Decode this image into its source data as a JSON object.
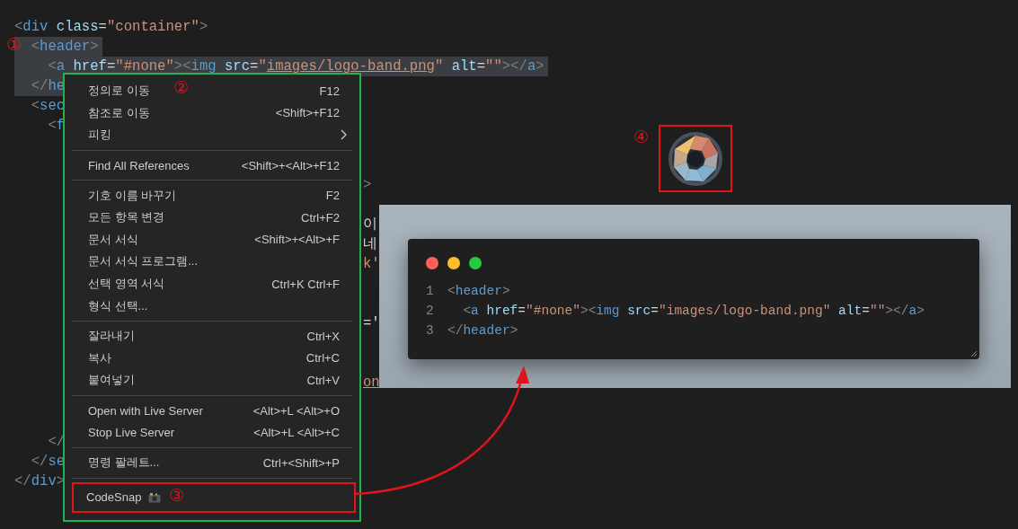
{
  "editor": {
    "lines": [
      {
        "kind": "code",
        "highlighted": false,
        "tokens": [
          {
            "text": "<",
            "kind": "punct"
          },
          {
            "text": "div",
            "kind": "tag"
          },
          {
            "text": " class",
            "kind": "attr"
          },
          {
            "text": "=",
            "kind": "text"
          },
          {
            "text": "\"container\"",
            "kind": "string"
          },
          {
            "text": ">",
            "kind": "punct"
          }
        ]
      },
      {
        "kind": "code",
        "highlighted": true,
        "tokens": [
          {
            "text": "  <",
            "kind": "punct"
          },
          {
            "text": "header",
            "kind": "tag"
          },
          {
            "text": ">",
            "kind": "punct"
          }
        ]
      },
      {
        "kind": "code",
        "highlighted": true,
        "tokens": [
          {
            "text": "    <",
            "kind": "punct"
          },
          {
            "text": "a",
            "kind": "tag"
          },
          {
            "text": " href",
            "kind": "attr"
          },
          {
            "text": "=",
            "kind": "text"
          },
          {
            "text": "\"#none\"",
            "kind": "string"
          },
          {
            "text": "><",
            "kind": "punct"
          },
          {
            "text": "img",
            "kind": "tag"
          },
          {
            "text": " src",
            "kind": "attr"
          },
          {
            "text": "=",
            "kind": "text"
          },
          {
            "text": "\"",
            "kind": "string"
          },
          {
            "text": "images/logo-band.png",
            "kind": "link"
          },
          {
            "text": "\"",
            "kind": "string"
          },
          {
            "text": " alt",
            "kind": "attr"
          },
          {
            "text": "=",
            "kind": "text"
          },
          {
            "text": "\"\"",
            "kind": "string"
          },
          {
            "text": "></",
            "kind": "punct"
          },
          {
            "text": "a",
            "kind": "tag"
          },
          {
            "text": ">",
            "kind": "punct"
          }
        ]
      },
      {
        "kind": "code",
        "highlighted": true,
        "tokens": [
          {
            "text": "  </",
            "kind": "punct"
          },
          {
            "text": "he",
            "kind": "tag"
          }
        ]
      },
      {
        "kind": "code",
        "highlighted": false,
        "tokens": [
          {
            "text": "  <",
            "kind": "punct"
          },
          {
            "text": "sec",
            "kind": "tag"
          }
        ]
      },
      {
        "kind": "code",
        "highlighted": false,
        "tokens": [
          {
            "text": "    <",
            "kind": "punct"
          },
          {
            "text": "f",
            "kind": "tag"
          }
        ]
      },
      {
        "kind": "blank"
      },
      {
        "kind": "blank"
      },
      {
        "kind": "tail",
        "tail": {
          "text": ">",
          "kind": "punct"
        }
      },
      {
        "kind": "blank"
      },
      {
        "kind": "tail",
        "tail": {
          "text": "이",
          "kind": "text"
        }
      },
      {
        "kind": "tail",
        "tail": {
          "text": "네",
          "kind": "text"
        }
      },
      {
        "kind": "tail",
        "tail": {
          "text": "k'",
          "kind": "string"
        }
      },
      {
        "kind": "blank"
      },
      {
        "kind": "blank"
      },
      {
        "kind": "tail",
        "tail": {
          "text": "='",
          "kind": "text"
        }
      },
      {
        "kind": "blank"
      },
      {
        "kind": "blank"
      },
      {
        "kind": "tail",
        "tail": {
          "text": "on",
          "kind": "link"
        }
      },
      {
        "kind": "blank"
      },
      {
        "kind": "blank"
      },
      {
        "kind": "code",
        "highlighted": false,
        "tokens": [
          {
            "text": "    </",
            "kind": "punct"
          }
        ]
      },
      {
        "kind": "code",
        "highlighted": false,
        "tokens": [
          {
            "text": "  </",
            "kind": "punct"
          },
          {
            "text": "se",
            "kind": "tag"
          }
        ]
      },
      {
        "kind": "code",
        "highlighted": false,
        "tokens": [
          {
            "text": "</",
            "kind": "punct"
          },
          {
            "text": "div",
            "kind": "tag"
          },
          {
            "text": ">",
            "kind": "punct"
          }
        ]
      }
    ]
  },
  "context_menu": {
    "groups": [
      [
        {
          "kind": "item",
          "label": "정의로 이동",
          "shortcut": "F12"
        },
        {
          "kind": "item",
          "label": "참조로 이동",
          "shortcut": "<Shift>+F12"
        },
        {
          "kind": "submenu",
          "label": "피킹"
        }
      ],
      [
        {
          "kind": "item",
          "label": "Find All References",
          "shortcut": "<Shift>+<Alt>+F12"
        }
      ],
      [
        {
          "kind": "item",
          "label": "기호 이름 바꾸기",
          "shortcut": "F2"
        },
        {
          "kind": "item",
          "label": "모든 항목 변경",
          "shortcut": "Ctrl+F2"
        },
        {
          "kind": "item",
          "label": "문서 서식",
          "shortcut": "<Shift>+<Alt>+F"
        },
        {
          "kind": "item",
          "label": "문서 서식 프로그램..."
        },
        {
          "kind": "item",
          "label": "선택 영역 서식",
          "shortcut": "Ctrl+K Ctrl+F"
        },
        {
          "kind": "item",
          "label": "형식 선택..."
        }
      ],
      [
        {
          "kind": "item",
          "label": "잘라내기",
          "shortcut": "Ctrl+X"
        },
        {
          "kind": "item",
          "label": "복사",
          "shortcut": "Ctrl+C"
        },
        {
          "kind": "item",
          "label": "붙여넣기",
          "shortcut": "Ctrl+V"
        }
      ],
      [
        {
          "kind": "item",
          "label": "Open with Live Server",
          "shortcut": "<Alt>+L <Alt>+O"
        },
        {
          "kind": "item",
          "label": "Stop Live Server",
          "shortcut": "<Alt>+L <Alt>+C"
        }
      ],
      [
        {
          "kind": "item",
          "label": "명령 팔레트...",
          "shortcut": "Ctrl+<Shift>+P"
        }
      ],
      [
        {
          "kind": "extension",
          "label": "CodeSnap"
        }
      ]
    ]
  },
  "snapshot": {
    "dots": [
      {
        "color": "#ff5f56"
      },
      {
        "color": "#ffbd2e"
      },
      {
        "color": "#27c93f"
      }
    ],
    "lines": [
      {
        "number": "1",
        "tokens": [
          {
            "text": "<",
            "kind": "punct"
          },
          {
            "text": "header",
            "kind": "tag"
          },
          {
            "text": ">",
            "kind": "punct"
          }
        ]
      },
      {
        "number": "2",
        "tokens": [
          {
            "text": "  <",
            "kind": "punct"
          },
          {
            "text": "a",
            "kind": "tag"
          },
          {
            "text": " href",
            "kind": "attr"
          },
          {
            "text": "=",
            "kind": "text"
          },
          {
            "text": "\"#none\"",
            "kind": "string"
          },
          {
            "text": "><",
            "kind": "punct"
          },
          {
            "text": "img",
            "kind": "tag"
          },
          {
            "text": " src",
            "kind": "attr"
          },
          {
            "text": "=",
            "kind": "text"
          },
          {
            "text": "\"images/logo-band.png\"",
            "kind": "string"
          },
          {
            "text": " alt",
            "kind": "attr"
          },
          {
            "text": "=",
            "kind": "text"
          },
          {
            "text": "\"\"",
            "kind": "string"
          },
          {
            "text": "></",
            "kind": "punct"
          },
          {
            "text": "a",
            "kind": "tag"
          },
          {
            "text": ">",
            "kind": "punct"
          }
        ]
      },
      {
        "number": "3",
        "tokens": [
          {
            "text": "</",
            "kind": "punct"
          },
          {
            "text": "header",
            "kind": "tag"
          },
          {
            "text": ">",
            "kind": "punct"
          }
        ]
      }
    ]
  },
  "annotations": [
    {
      "label": "①"
    },
    {
      "label": "②"
    },
    {
      "label": "③"
    },
    {
      "label": "④"
    }
  ]
}
